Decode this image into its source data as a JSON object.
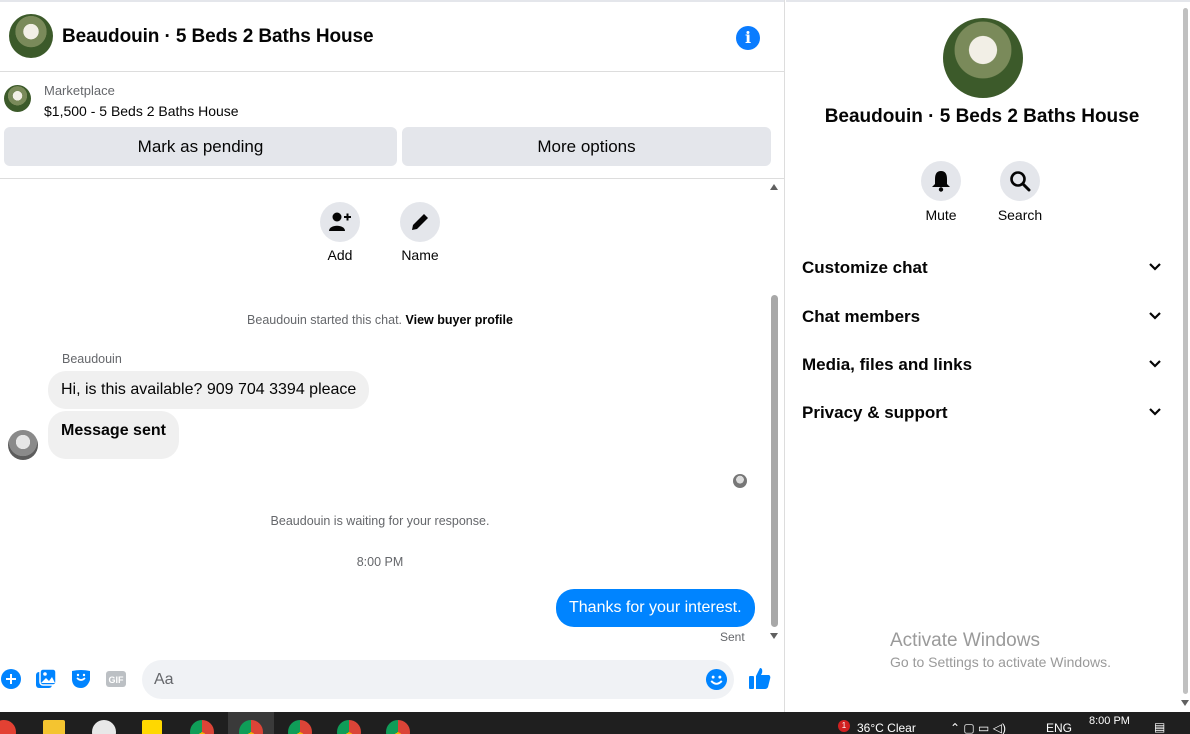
{
  "header": {
    "title": "Beaudouin · 5 Beds 2 Baths House",
    "info_icon": "info-icon"
  },
  "marketplace": {
    "label": "Marketplace",
    "listing": "$1,500 - 5 Beds 2 Baths House",
    "mark_pending_label": "Mark as pending",
    "more_options_label": "More options"
  },
  "chat_actions": {
    "add_label": "Add",
    "name_label": "Name"
  },
  "messages": {
    "started_text": "Beaudouin started this chat.",
    "view_profile_link": "View buyer profile",
    "sender_name": "Beaudouin",
    "incoming": [
      "Hi, is this available? 909 704 3394 pleace",
      "Message sent"
    ],
    "waiting_text": "Beaudouin is waiting for your response.",
    "timestamp": "8:00 PM",
    "outgoing": "Thanks for your interest.",
    "sent_status": "Sent"
  },
  "composer": {
    "placeholder": "Aa"
  },
  "details": {
    "title": "Beaudouin · 5 Beds 2 Baths House",
    "mute_label": "Mute",
    "search_label": "Search",
    "sections": [
      "Customize chat",
      "Chat members",
      "Media, files and links",
      "Privacy & support"
    ]
  },
  "watermark": {
    "line1": "Activate Windows",
    "line2": "Go to Settings to activate Windows."
  },
  "taskbar": {
    "notification_count": "1",
    "weather": "36°C  Clear",
    "language": "ENG",
    "clock": "8:00 PM"
  },
  "colors": {
    "accent": "#0084ff",
    "bubble_in": "#f0f0f0",
    "button_gray": "#e4e6eb"
  }
}
